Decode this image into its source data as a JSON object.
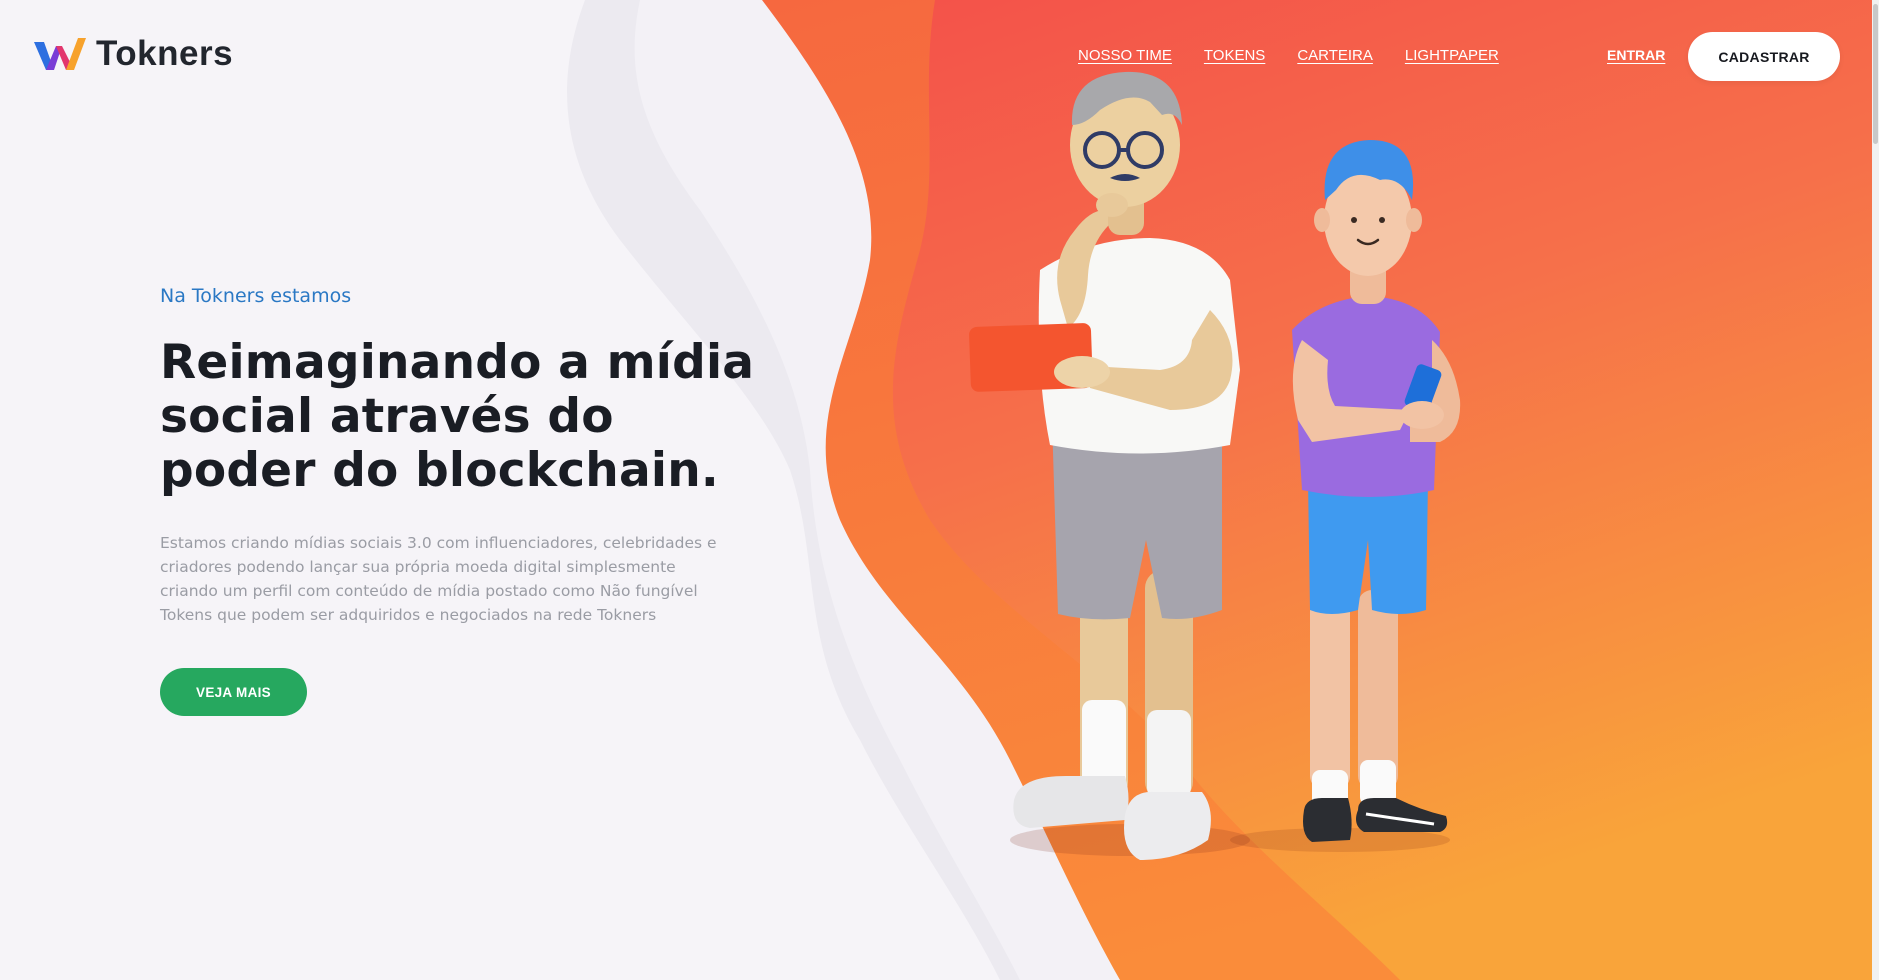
{
  "header": {
    "brand": "Tokners",
    "nav": [
      {
        "label": "NOSSO TIME"
      },
      {
        "label": "TOKENS"
      },
      {
        "label": "CARTEIRA"
      },
      {
        "label": "LIGHTPAPER"
      }
    ],
    "login_label": "ENTRAR",
    "signup_label": "CADASTRAR"
  },
  "hero": {
    "kicker": "Na Tokners estamos",
    "headline": "Reimaginando a mídia social através do poder do blockchain.",
    "paragraph": "Estamos criando mídias sociais 3.0 com influenciadores, celebridades e criadores podendo lançar sua própria moeda digital simplesmente criando um perfil com conteúdo de mídia postado como Não fungível Tokens que podem ser adquiridos e negociados na rede Tokners",
    "cta_label": "VEJA MAIS"
  },
  "icons": {
    "logo": "tokners-w-logo-icon",
    "illustration": "two-people-with-devices-illustration"
  },
  "colors": {
    "accent_orange": "#f4524a",
    "accent_orange_light": "#f99a3c",
    "kicker_blue": "#2a78c4",
    "cta_green": "#26a85f",
    "headline": "#1a1d24",
    "body_text": "#9a9ca4"
  }
}
